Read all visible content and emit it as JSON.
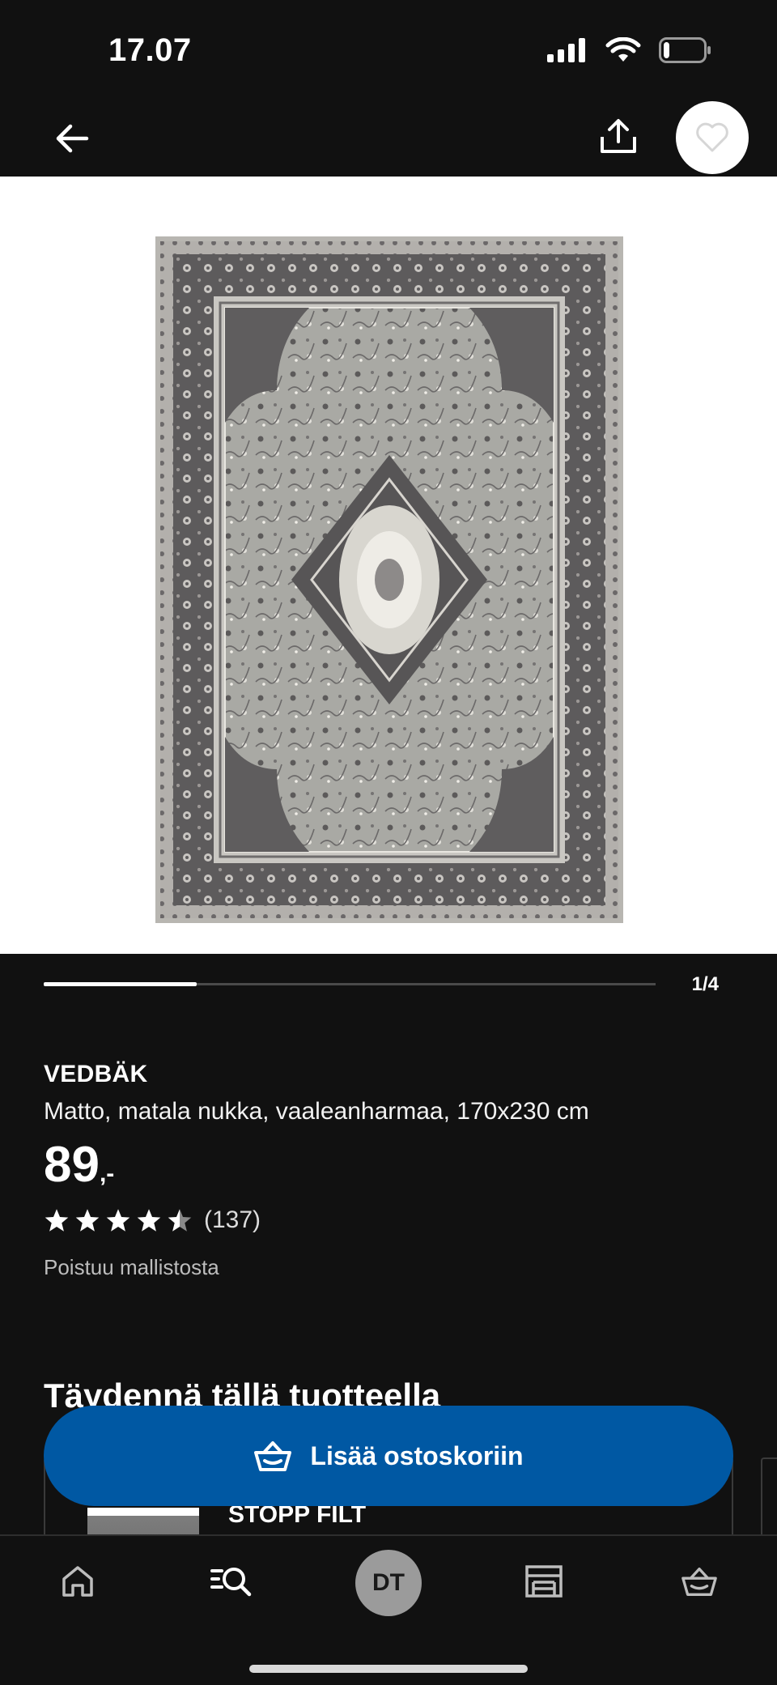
{
  "status_bar": {
    "time": "17.07",
    "battery_level": 0.15
  },
  "product_images": {
    "current": 1,
    "total": 4,
    "counter": "1/4",
    "progress": 0.25
  },
  "product": {
    "name": "VEDBÄK",
    "description": "Matto, matala nukka, vaaleanharmaa, 170x230 cm",
    "price": "89",
    "price_suffix": ",-",
    "rating": 4.5,
    "rating_max": 5,
    "review_count": "(137)",
    "availability": "Poistuu mallistosta"
  },
  "complement_section": {
    "title": "Täydennä tällä tuotteella",
    "items": [
      {
        "name": "STOPP FILT"
      }
    ]
  },
  "cart_button": {
    "label": "Lisää ostoskoriin"
  },
  "tab_bar": {
    "tabs": [
      {
        "name": "home",
        "icon": "home-icon"
      },
      {
        "name": "search",
        "icon": "search-icon"
      },
      {
        "name": "profile",
        "avatar_initials": "DT"
      },
      {
        "name": "stores",
        "icon": "store-icon"
      },
      {
        "name": "cart",
        "icon": "basket-icon"
      }
    ]
  },
  "colors": {
    "accent": "#0058a3",
    "background": "#111111",
    "image_background": "#ffffff"
  }
}
